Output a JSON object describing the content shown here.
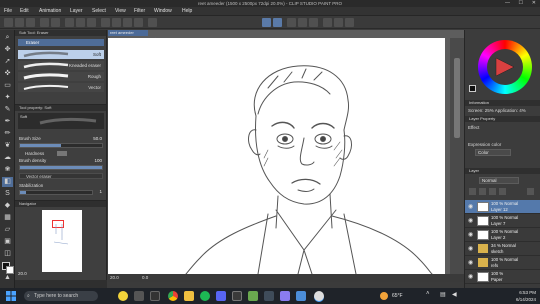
{
  "window": {
    "title": "reet ameeder (1500 x 2500px 72dpi 20.0%) - CLIP STUDIO PAINT PRO",
    "controls": [
      "—",
      "☐",
      "✕"
    ]
  },
  "menu": [
    "File",
    "Edit",
    "Animation",
    "Layer",
    "Select",
    "View",
    "Filter",
    "Window",
    "Help"
  ],
  "subtool": {
    "panel_title": "Sub Tool: Eraser",
    "tool_name": "Eraser",
    "brushes": [
      "Soft",
      "Kneaded eraser",
      "Rough",
      "Vector"
    ]
  },
  "toolprop": {
    "panel_title": "Tool property: Soft",
    "brush_preview_name": "Soft",
    "brush_size_label": "Brush Size",
    "brush_size_value": "50.0",
    "brush_size_frac": 0.5,
    "hardness_label": "Hardness",
    "brush_density_label": "Brush density",
    "brush_density_value": "100",
    "brush_density_frac": 1.0,
    "vector_eraser_label": "Vector eraser",
    "stabilization_label": "Stabilization",
    "stabilization_value": "1"
  },
  "navigator": {
    "panel_title": "Navigator",
    "zoom": "20.0",
    "rotation": "0.0"
  },
  "canvas": {
    "tab_label": "reet ameeder",
    "status_zoom": "20.0",
    "status_coords": "0.0"
  },
  "right": {
    "info_label": "Information",
    "layer_property_label": "Layer Property",
    "status_line": "Screen: 25%  Application: 4%",
    "effect_label": "Effect",
    "expression_color_label": "Expression color",
    "expression_color_value": "Color",
    "layer_tab": "Layer",
    "blend_mode": "Normal",
    "layers": [
      {
        "line1": "100 % Normal",
        "line2": "Layer 12",
        "selected": true,
        "folder": false
      },
      {
        "line1": "100 % Normal",
        "line2": "Layer 7",
        "selected": false,
        "folder": false
      },
      {
        "line1": "100 % Normal",
        "line2": "Layer 2",
        "selected": false,
        "folder": false
      },
      {
        "line1": "34 % Normal",
        "line2": "sketch",
        "selected": false,
        "folder": true
      },
      {
        "line1": "100 % Normal",
        "line2": "refs",
        "selected": false,
        "folder": true
      },
      {
        "line1": "100 %",
        "line2": "Paper",
        "selected": false,
        "folder": false
      }
    ]
  },
  "taskbar": {
    "search_placeholder": "Type here to search",
    "temperature": "65°F",
    "time": "6:53 PM",
    "date": "6/14/2024"
  },
  "colors": {
    "accent": "#5479ab",
    "primary_color": "#111111",
    "secondary_color": "#ffffff"
  }
}
